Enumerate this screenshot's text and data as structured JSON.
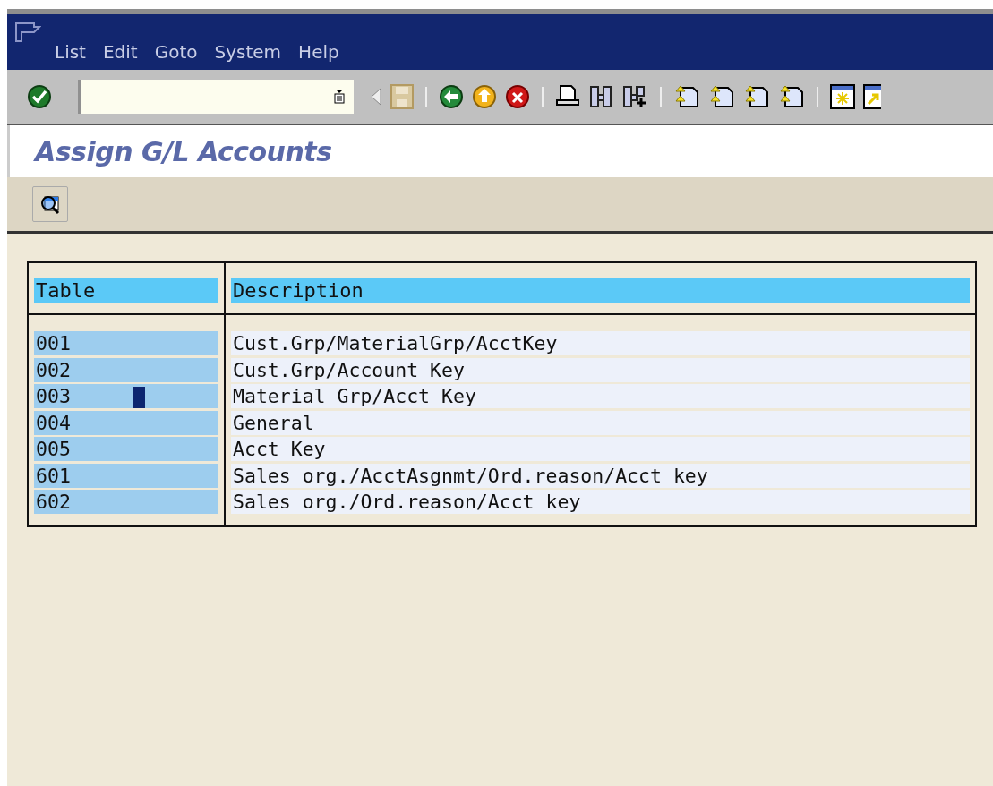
{
  "menu": [
    "List",
    "Edit",
    "Goto",
    "System",
    "Help"
  ],
  "title": "Assign G/L Accounts",
  "table": {
    "columns": [
      "Table",
      "Description"
    ],
    "rows": [
      {
        "table": "001",
        "description": "Cust.Grp/MaterialGrp/AcctKey",
        "cursor": false
      },
      {
        "table": "002",
        "description": "Cust.Grp/Account Key",
        "cursor": false
      },
      {
        "table": "003",
        "description": "Material Grp/Acct Key",
        "cursor": true
      },
      {
        "table": "004",
        "description": "General",
        "cursor": false
      },
      {
        "table": "005",
        "description": "Acct Key",
        "cursor": false
      },
      {
        "table": "601",
        "description": "Sales org./AcctAsgnmt/Ord.reason/Acct key",
        "cursor": false
      },
      {
        "table": "602",
        "description": "Sales org./Ord.reason/Acct key",
        "cursor": false
      }
    ]
  }
}
